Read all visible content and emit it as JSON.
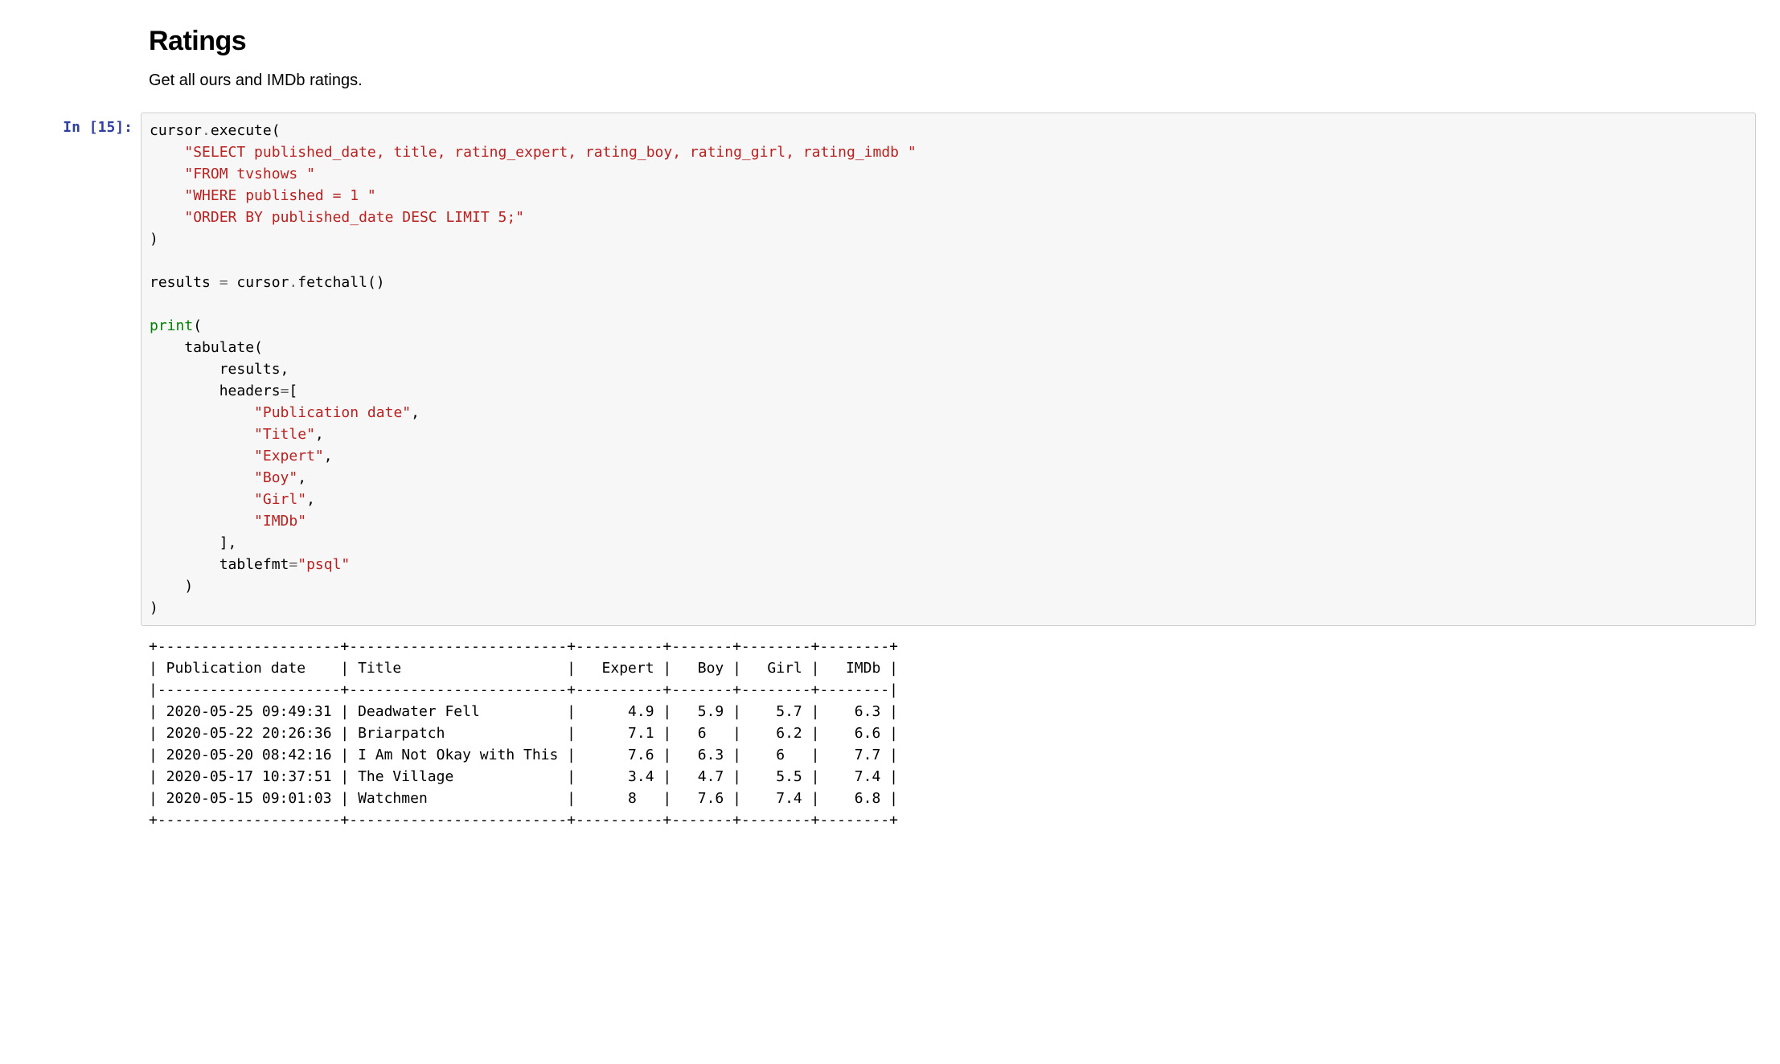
{
  "section": {
    "title": "Ratings",
    "description": "Get all ours and IMDb ratings."
  },
  "prompt": {
    "label": "In [15]:"
  },
  "code": {
    "l01a": "cursor",
    "l01b": ".",
    "l01c": "execute(",
    "l02a": "    ",
    "l02b": "\"SELECT published_date, title, rating_expert, rating_boy, rating_girl, rating_imdb \"",
    "l03a": "    ",
    "l03b": "\"FROM tvshows \"",
    "l04a": "    ",
    "l04b": "\"WHERE published = 1 \"",
    "l05a": "    ",
    "l05b": "\"ORDER BY published_date DESC LIMIT 5;\"",
    "l06": ")",
    "l07": "",
    "l08a": "results ",
    "l08b": "=",
    "l08c": " cursor",
    "l08d": ".",
    "l08e": "fetchall()",
    "l09": "",
    "l10a": "print",
    "l10b": "(",
    "l11": "    tabulate(",
    "l12": "        results,",
    "l13a": "        headers",
    "l13b": "=",
    "l13c": "[",
    "l14a": "            ",
    "l14b": "\"Publication date\"",
    "l14c": ",",
    "l15a": "            ",
    "l15b": "\"Title\"",
    "l15c": ",",
    "l16a": "            ",
    "l16b": "\"Expert\"",
    "l16c": ",",
    "l17a": "            ",
    "l17b": "\"Boy\"",
    "l17c": ",",
    "l18a": "            ",
    "l18b": "\"Girl\"",
    "l18c": ",",
    "l19a": "            ",
    "l19b": "\"IMDb\"",
    "l20": "        ],",
    "l21a": "        tablefmt",
    "l21b": "=",
    "l21c": "\"psql\"",
    "l22": "    )",
    "l23": ")"
  },
  "output": {
    "text": "+---------------------+-------------------------+----------+-------+--------+--------+\n| Publication date    | Title                   |   Expert |   Boy |   Girl |   IMDb |\n|---------------------+-------------------------+----------+-------+--------+--------|\n| 2020-05-25 09:49:31 | Deadwater Fell          |      4.9 |   5.9 |    5.7 |    6.3 |\n| 2020-05-22 20:26:36 | Briarpatch              |      7.1 |   6   |    6.2 |    6.6 |\n| 2020-05-20 08:42:16 | I Am Not Okay with This |      7.6 |   6.3 |    6   |    7.7 |\n| 2020-05-17 10:37:51 | The Village             |      3.4 |   4.7 |    5.5 |    7.4 |\n| 2020-05-15 09:01:03 | Watchmen                |      8   |   7.6 |    7.4 |    6.8 |\n+---------------------+-------------------------+----------+-------+--------+--------+"
  },
  "chart_data": {
    "type": "table",
    "columns": [
      "Publication date",
      "Title",
      "Expert",
      "Boy",
      "Girl",
      "IMDb"
    ],
    "rows": [
      [
        "2020-05-25 09:49:31",
        "Deadwater Fell",
        4.9,
        5.9,
        5.7,
        6.3
      ],
      [
        "2020-05-22 20:26:36",
        "Briarpatch",
        7.1,
        6,
        6.2,
        6.6
      ],
      [
        "2020-05-20 08:42:16",
        "I Am Not Okay with This",
        7.6,
        6.3,
        6,
        7.7
      ],
      [
        "2020-05-17 10:37:51",
        "The Village",
        3.4,
        4.7,
        5.5,
        7.4
      ],
      [
        "2020-05-15 09:01:03",
        "Watchmen",
        8,
        7.6,
        7.4,
        6.8
      ]
    ]
  }
}
